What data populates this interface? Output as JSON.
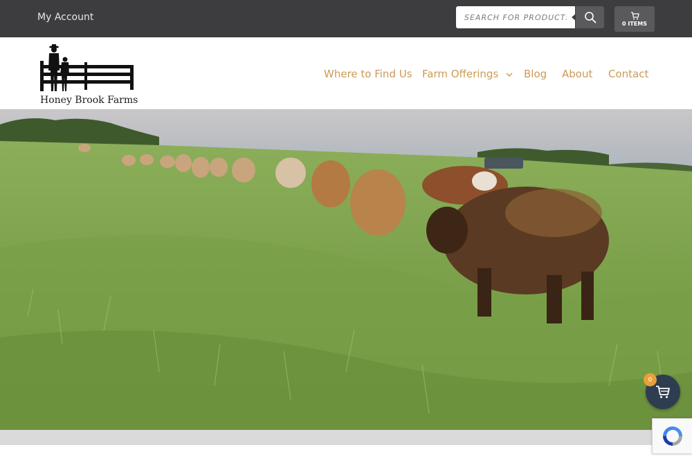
{
  "topbar": {
    "account_label": "My Account",
    "search": {
      "placeholder": "SEARCH FOR PRODUCTS...",
      "icon": "search-icon"
    },
    "cart": {
      "label": "0 ITEMS",
      "icon": "cart-icon"
    }
  },
  "header": {
    "logo": {
      "text": "Honey Brook Farms"
    },
    "nav": [
      {
        "label": "Where to Find Us"
      },
      {
        "label": "Farm Offerings",
        "dropdown": true
      },
      {
        "label": "Blog"
      },
      {
        "label": "About"
      },
      {
        "label": "Contact"
      }
    ]
  },
  "hero": {
    "image": "cattle walking single file through tall green pasture"
  },
  "floating_cart": {
    "count": "0",
    "icon": "cart-icon"
  },
  "recaptcha": {
    "icon": "recaptcha-icon"
  },
  "colors": {
    "topbar_bg": "#3d3d3f",
    "nav_text": "#cc9a55",
    "floating_cart_bg": "#2f3d50",
    "badge_bg": "#e8a03a"
  }
}
